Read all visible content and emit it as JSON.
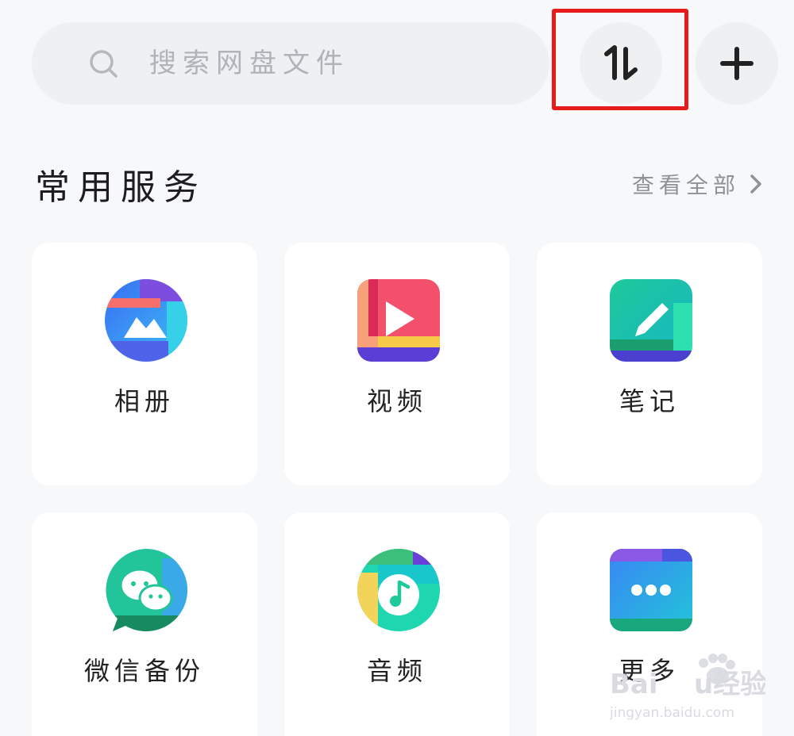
{
  "search": {
    "placeholder": "搜索网盘文件",
    "icon": "search-icon"
  },
  "toolbar": {
    "sort_icon": "sort-transfer-icon",
    "add_icon": "plus-icon"
  },
  "section": {
    "title": "常用服务",
    "view_all": "查看全部",
    "view_all_icon": "chevron-right-icon"
  },
  "services": [
    {
      "label": "相册",
      "icon": "photo-album-icon"
    },
    {
      "label": "视频",
      "icon": "video-play-icon"
    },
    {
      "label": "笔记",
      "icon": "note-pen-icon"
    },
    {
      "label": "微信备份",
      "icon": "wechat-backup-icon"
    },
    {
      "label": "音频",
      "icon": "music-note-icon"
    },
    {
      "label": "更多",
      "icon": "more-dots-icon"
    }
  ],
  "watermark": {
    "brand": "Baidu经验",
    "url": "jingyan.baidu.com"
  },
  "colors": {
    "background": "#f7f8f9",
    "highlight": "#e61c1c"
  }
}
